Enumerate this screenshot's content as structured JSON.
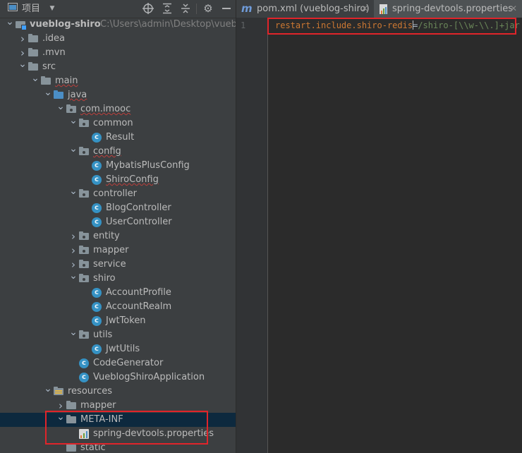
{
  "project_toolbar": {
    "label": "项目",
    "icons": [
      "project-view-icon",
      "dropdown-arrow-icon",
      "locate-icon",
      "expand-all-icon",
      "collapse-all-icon",
      "settings-gear-icon",
      "hide-panel-icon"
    ]
  },
  "tree": [
    {
      "name": "vueblog-shiro",
      "type": "module",
      "indent": 0,
      "chev": "down",
      "bold": true,
      "path": "C:\\Users\\admin\\Desktop\\vueblog-"
    },
    {
      "name": ".idea",
      "type": "folder",
      "indent": 1,
      "chev": "right"
    },
    {
      "name": ".mvn",
      "type": "folder",
      "indent": 1,
      "chev": "right"
    },
    {
      "name": "src",
      "type": "folder",
      "indent": 1,
      "chev": "down"
    },
    {
      "name": "main",
      "type": "folder",
      "indent": 2,
      "chev": "down",
      "squiggle": true
    },
    {
      "name": "java",
      "type": "folder-blue",
      "indent": 3,
      "chev": "down",
      "squiggle": true
    },
    {
      "name": "com.imooc",
      "type": "package",
      "indent": 4,
      "chev": "down",
      "squiggle": true
    },
    {
      "name": "common",
      "type": "package",
      "indent": 5,
      "chev": "down"
    },
    {
      "name": "Result",
      "type": "class",
      "indent": 6
    },
    {
      "name": "config",
      "type": "package",
      "indent": 5,
      "chev": "down",
      "squiggle": true
    },
    {
      "name": "MybatisPlusConfig",
      "type": "class",
      "indent": 6
    },
    {
      "name": "ShiroConfig",
      "type": "class",
      "indent": 6,
      "squiggle": true
    },
    {
      "name": "controller",
      "type": "package",
      "indent": 5,
      "chev": "down"
    },
    {
      "name": "BlogController",
      "type": "class",
      "indent": 6
    },
    {
      "name": "UserController",
      "type": "class",
      "indent": 6
    },
    {
      "name": "entity",
      "type": "package",
      "indent": 5,
      "chev": "right"
    },
    {
      "name": "mapper",
      "type": "package",
      "indent": 5,
      "chev": "right"
    },
    {
      "name": "service",
      "type": "package",
      "indent": 5,
      "chev": "right"
    },
    {
      "name": "shiro",
      "type": "package",
      "indent": 5,
      "chev": "down"
    },
    {
      "name": "AccountProfile",
      "type": "class",
      "indent": 6
    },
    {
      "name": "AccountRealm",
      "type": "class",
      "indent": 6
    },
    {
      "name": "JwtToken",
      "type": "class",
      "indent": 6
    },
    {
      "name": "utils",
      "type": "package",
      "indent": 5,
      "chev": "down"
    },
    {
      "name": "JwtUtils",
      "type": "class",
      "indent": 6
    },
    {
      "name": "CodeGenerator",
      "type": "class",
      "indent": 5
    },
    {
      "name": "VueblogShiroApplication",
      "type": "class",
      "indent": 5
    },
    {
      "name": "resources",
      "type": "folder-res",
      "indent": 3,
      "chev": "down"
    },
    {
      "name": "mapper",
      "type": "folder",
      "indent": 4,
      "chev": "right"
    },
    {
      "name": "META-INF",
      "type": "folder",
      "indent": 4,
      "chev": "down",
      "selected": true
    },
    {
      "name": "spring-devtools.properties",
      "type": "properties",
      "indent": 5
    },
    {
      "name": "static",
      "type": "folder",
      "indent": 4
    }
  ],
  "tabs": [
    {
      "label": "pom.xml (vueblog-shiro)",
      "icon": "maven-icon",
      "icon_text": "m",
      "active": false
    },
    {
      "label": "spring-devtools.properties",
      "icon": "properties-file-icon",
      "active": true
    }
  ],
  "editor": {
    "line_number": "1",
    "key": "restart.include.shiro-redis",
    "separator": "=",
    "value": "/shiro-[\\\\w-\\\\.]+jar"
  },
  "colors": {
    "highlight_border": "#e0242a",
    "panel_bg": "#3c3f41",
    "editor_bg": "#2b2b2b",
    "selection_bg": "#0d293e"
  }
}
